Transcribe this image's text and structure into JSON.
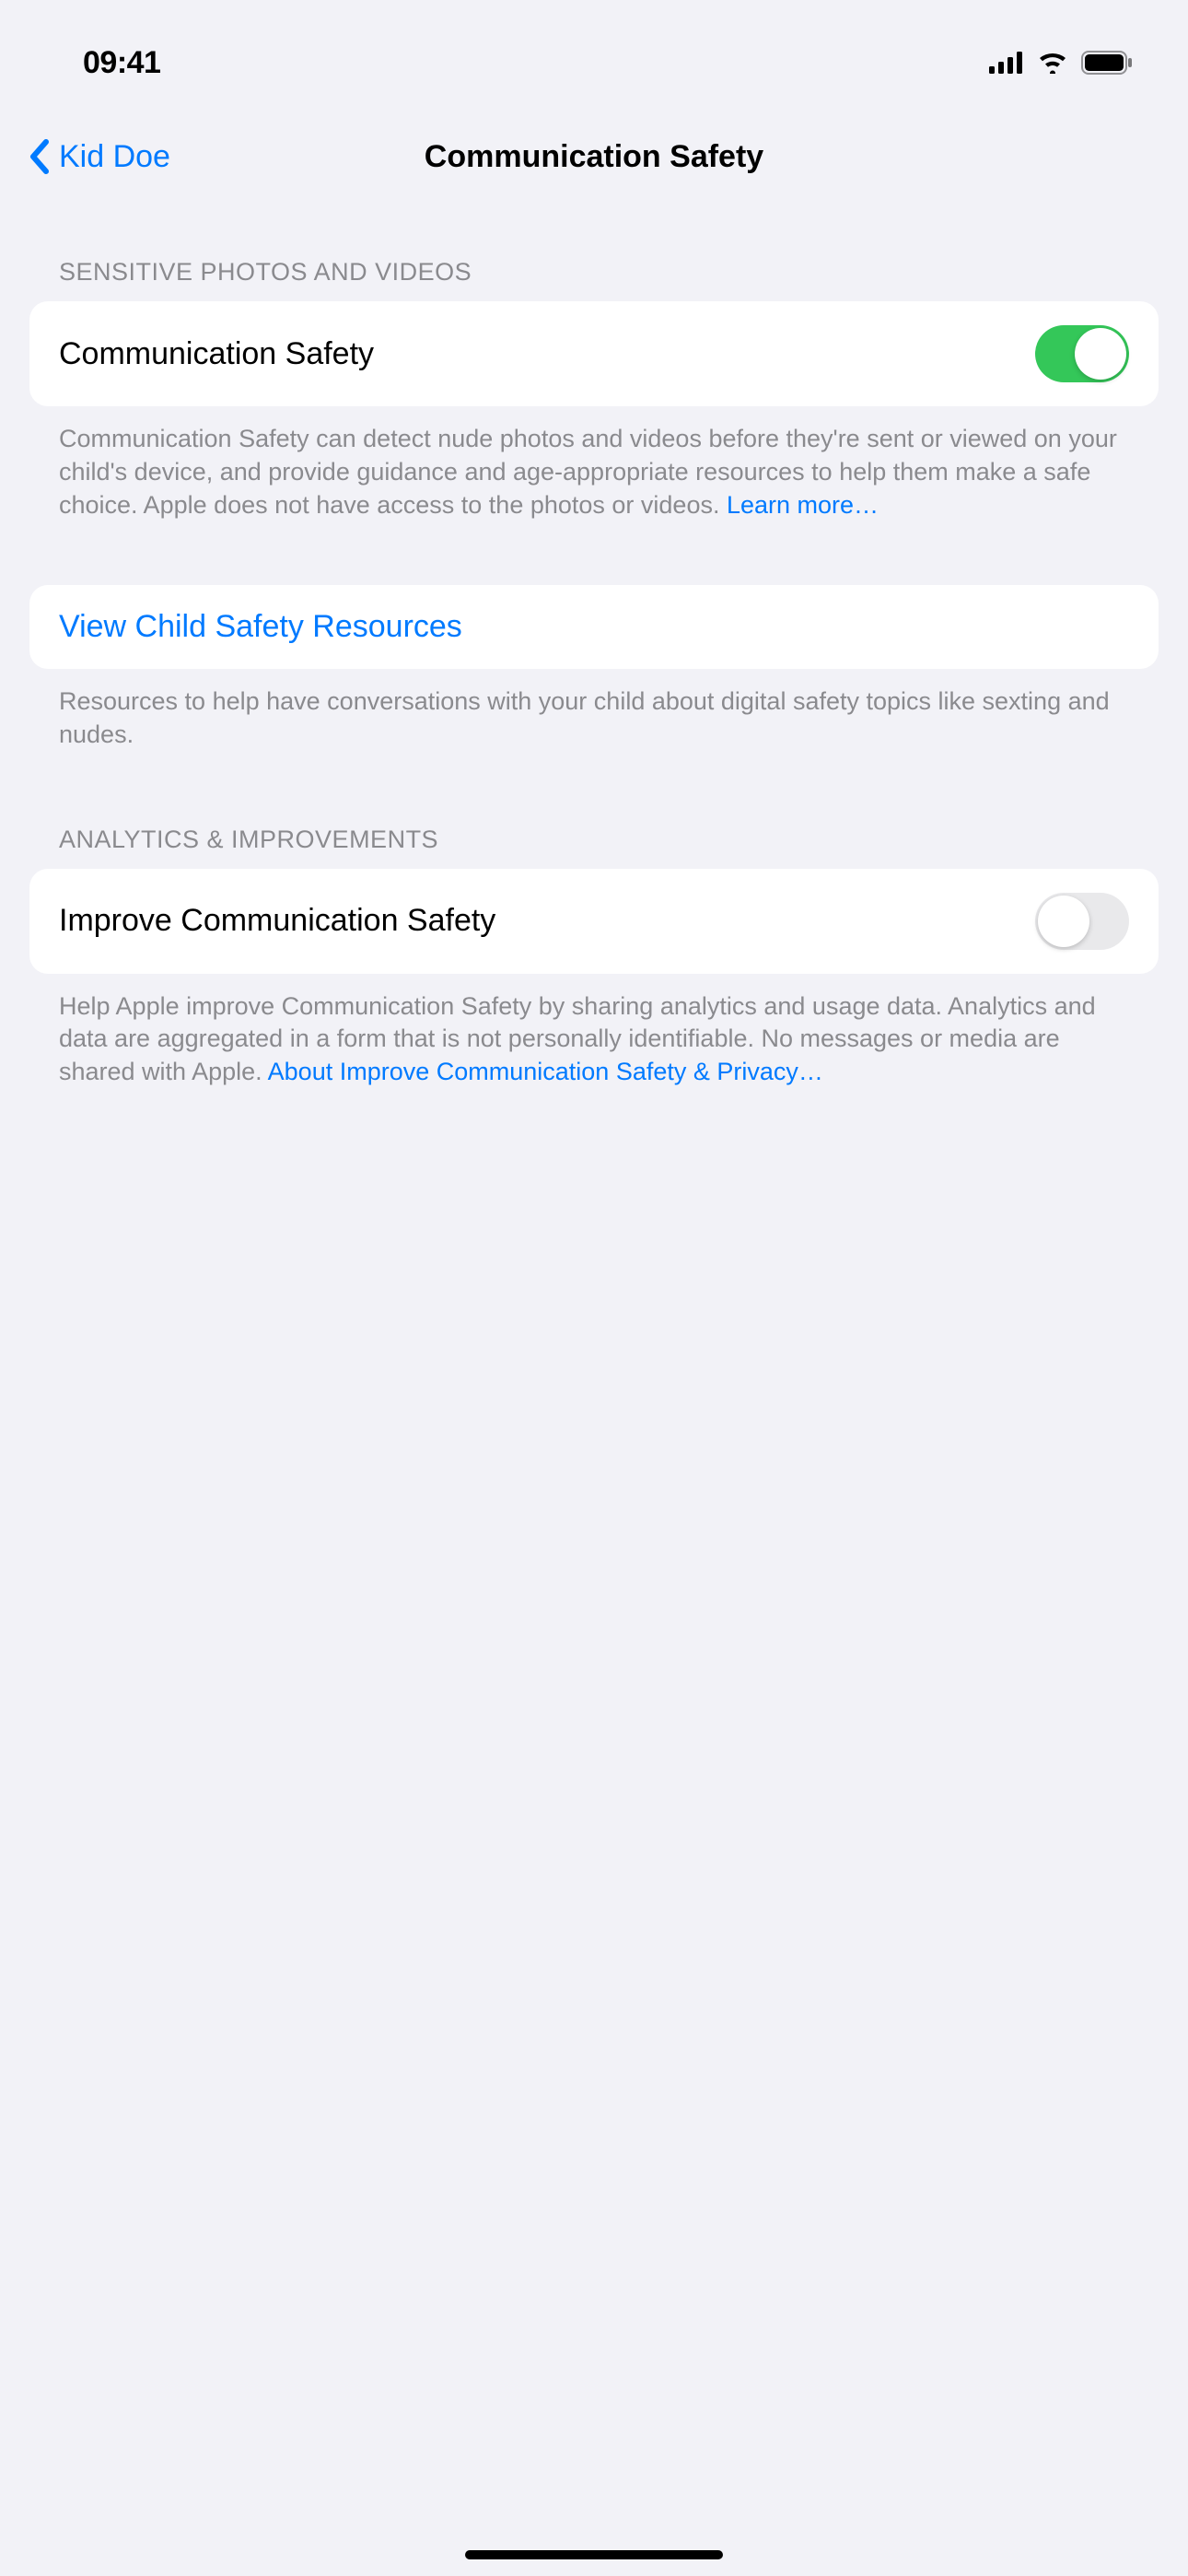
{
  "statusBar": {
    "time": "09:41"
  },
  "nav": {
    "backLabel": "Kid Doe",
    "title": "Communication Safety"
  },
  "section1": {
    "header": "SENSITIVE PHOTOS AND VIDEOS",
    "toggleLabel": "Communication Safety",
    "toggleOn": true,
    "footerText": "Communication Safety can detect nude photos and videos before they're sent or viewed on your child's device, and provide guidance and age-appropriate resources to help them make a safe choice. Apple does not have access to the photos or videos. ",
    "footerLink": "Learn more…"
  },
  "section2": {
    "linkLabel": "View Child Safety Resources",
    "footerText": "Resources to help have conversations with your child about digital safety topics like sexting and nudes."
  },
  "section3": {
    "header": "ANALYTICS & IMPROVEMENTS",
    "toggleLabel": "Improve Communication Safety",
    "toggleOn": false,
    "footerText": "Help Apple improve Communication Safety by sharing analytics and usage data. Analytics and data are aggregated in a form that is not personally identifiable. No messages or media are shared with Apple. ",
    "footerLink": "About Improve Communication Safety & Privacy…"
  }
}
